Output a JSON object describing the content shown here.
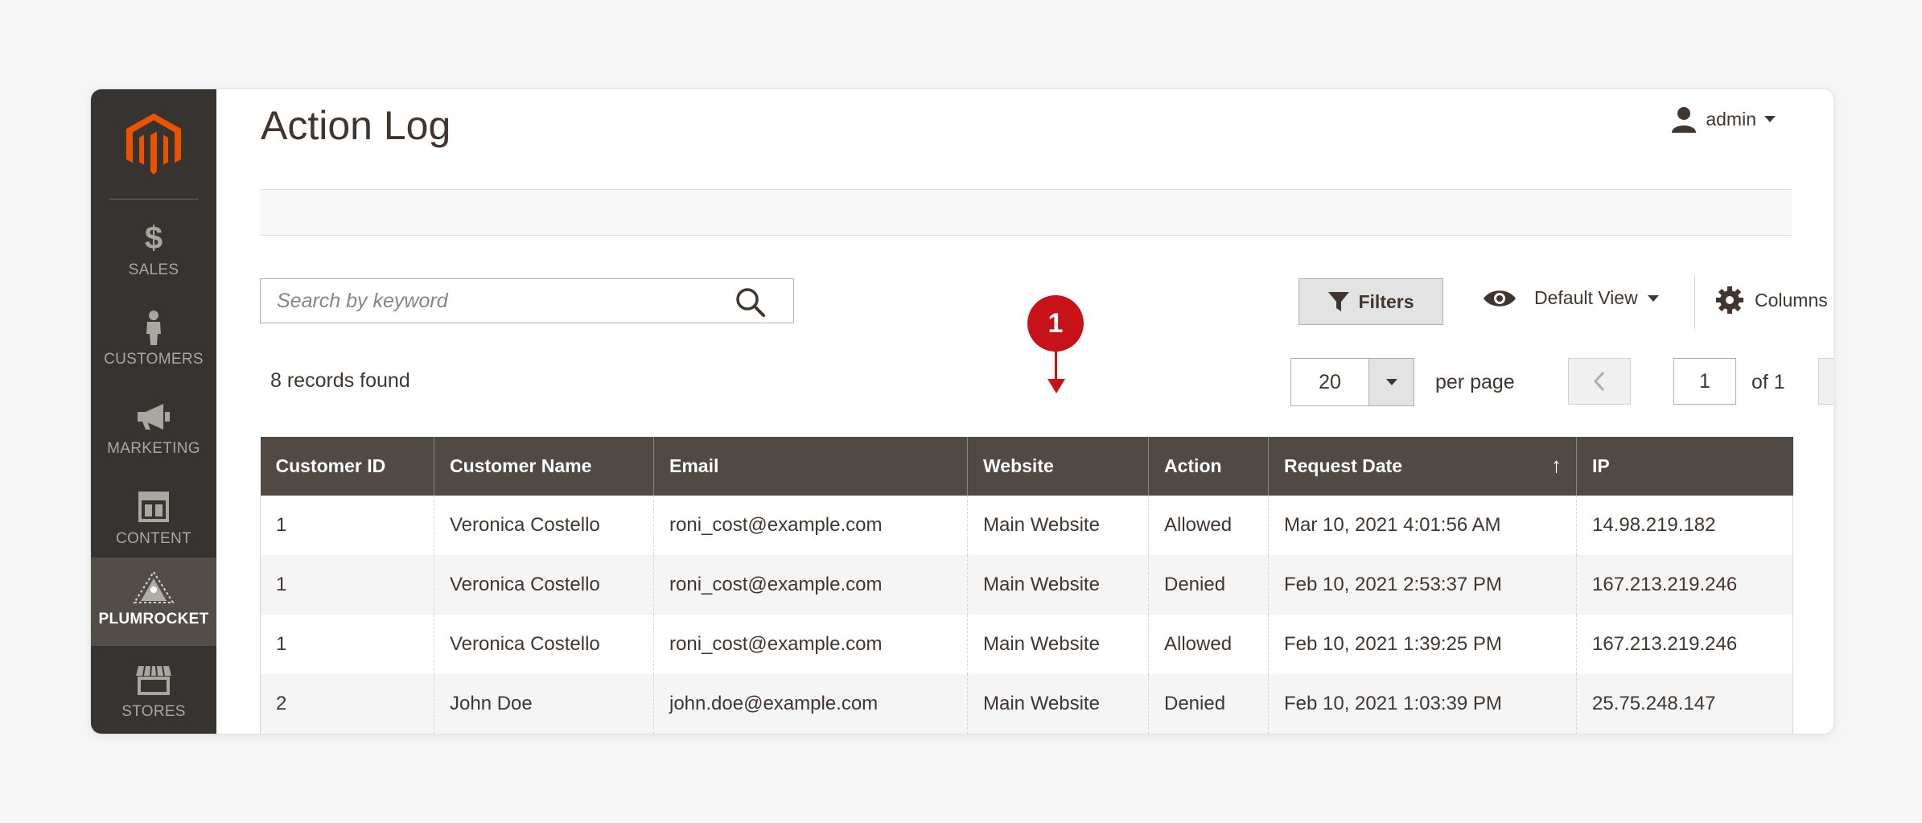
{
  "sidebar": {
    "items": [
      {
        "label": "SALES",
        "icon": "dollar-icon"
      },
      {
        "label": "CUSTOMERS",
        "icon": "customer-icon"
      },
      {
        "label": "MARKETING",
        "icon": "megaphone-icon"
      },
      {
        "label": "CONTENT",
        "icon": "layout-icon"
      },
      {
        "label": "PLUMROCKET",
        "icon": "plumrocket-icon",
        "active": true
      },
      {
        "label": "STORES",
        "icon": "store-icon"
      }
    ]
  },
  "header": {
    "title": "Action Log",
    "user": "admin"
  },
  "toolbar": {
    "search_placeholder": "Search by keyword",
    "filters_label": "Filters",
    "view_label": "Default View",
    "columns_label": "Columns"
  },
  "records": "8 records found",
  "pagination": {
    "per_page": "20",
    "per_page_label": "per page",
    "current_page": "1",
    "of_label": "of 1"
  },
  "callout": "1",
  "table": {
    "columns": [
      "Customer ID",
      "Customer Name",
      "Email",
      "Website",
      "Action",
      "Request Date",
      "IP"
    ],
    "sorted_column": "Request Date",
    "rows": [
      [
        "1",
        "Veronica Costello",
        "roni_cost@example.com",
        "Main Website",
        "Allowed",
        "Mar 10, 2021 4:01:56 AM",
        "14.98.219.182"
      ],
      [
        "1",
        "Veronica Costello",
        "roni_cost@example.com",
        "Main Website",
        "Denied",
        "Feb 10, 2021 2:53:37 PM",
        "167.213.219.246"
      ],
      [
        "1",
        "Veronica Costello",
        "roni_cost@example.com",
        "Main Website",
        "Allowed",
        "Feb 10, 2021 1:39:25 PM",
        "167.213.219.246"
      ],
      [
        "2",
        "John Doe",
        "john.doe@example.com",
        "Main Website",
        "Denied",
        "Feb 10, 2021 1:03:39 PM",
        "25.75.248.147"
      ]
    ]
  },
  "colors": {
    "sidebar": "#373330",
    "sidebar_active": "#524d49",
    "header_row": "#514943",
    "logo": "#eb5202",
    "callout": "#c8121a",
    "text": "#41362f"
  }
}
